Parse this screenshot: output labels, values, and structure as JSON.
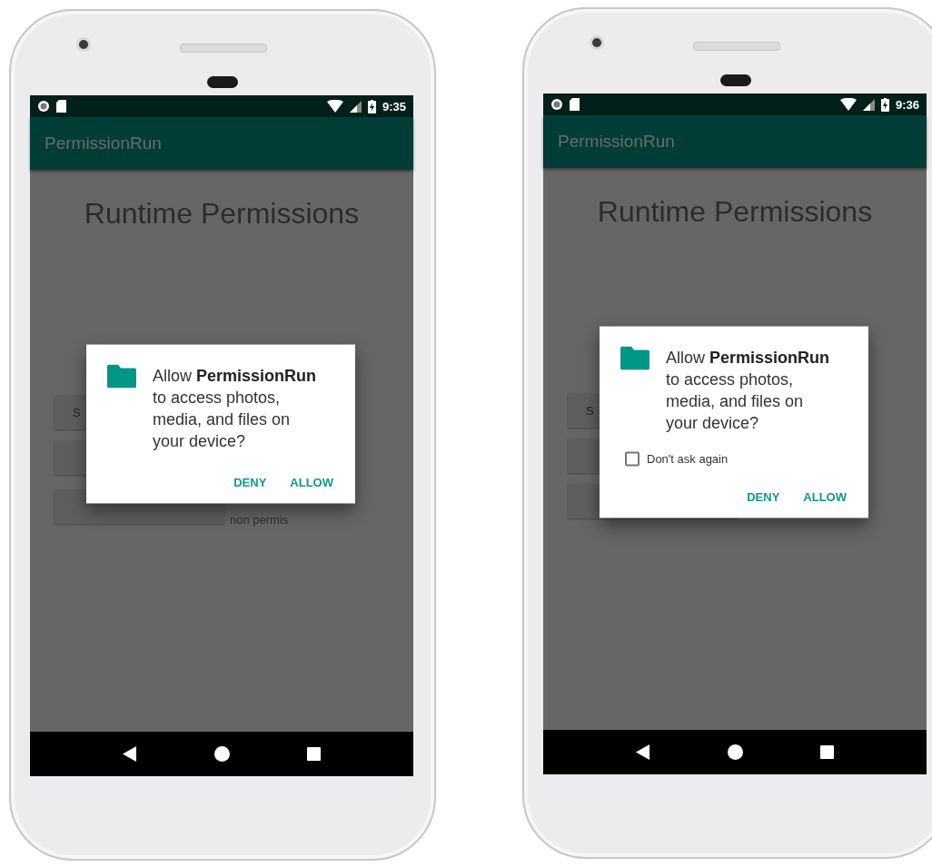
{
  "phones": [
    {
      "status_bar": {
        "time": "9:35"
      },
      "app_bar": {
        "title": "PermissionRun"
      },
      "heading": "Runtime Permissions",
      "buttons": [
        {
          "kind": "labeled",
          "label": "S"
        },
        {
          "kind": "blank"
        },
        {
          "kind": "blank"
        }
      ],
      "note": "non permis",
      "dialog": {
        "message_lines": [
          "Allow **PermissionRun**",
          "to access photos,",
          "media, and files on",
          "your device?"
        ],
        "actions": [
          "DENY",
          "ALLOW"
        ]
      }
    },
    {
      "status_bar": {
        "time": "9:36"
      },
      "app_bar": {
        "title": "PermissionRun"
      },
      "heading": "Runtime Permissions",
      "buttons": [
        {
          "kind": "labeled",
          "label": "S"
        },
        {
          "kind": "blank"
        },
        {
          "kind": "blank"
        }
      ],
      "dialog": {
        "message_lines": [
          "Allow **PermissionRun**",
          "to access photos,",
          "media, and files on",
          "your device?"
        ],
        "dont_ask_again": {
          "label": "Don't ask again",
          "checked": false
        },
        "actions": [
          "DENY",
          "ALLOW"
        ]
      }
    }
  ]
}
